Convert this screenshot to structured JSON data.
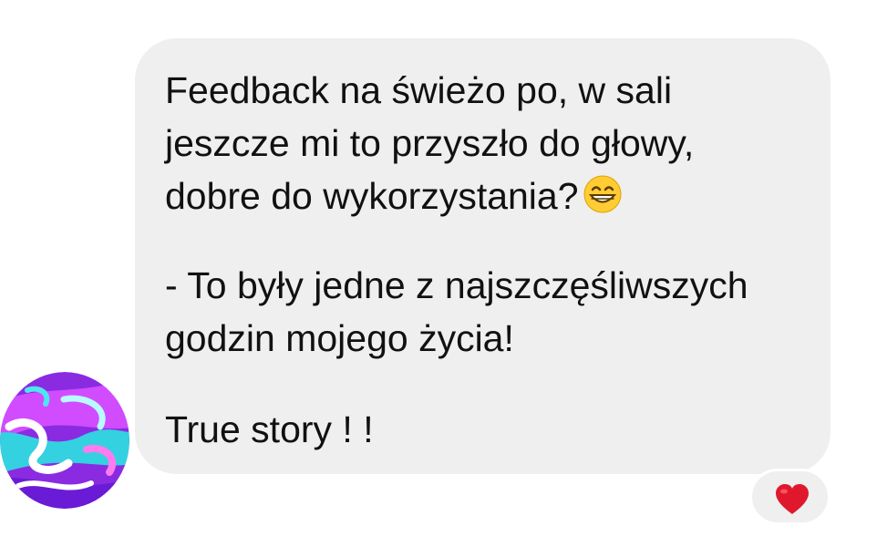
{
  "message": {
    "lines": [
      "Feedback na świeżo po, w sali",
      "jeszcze mi to przyszło do głowy,",
      "dobre do wykorzystania?",
      "- To były jedne z najszczęśliwszych",
      "godzin mojego życia!",
      "True story ! !"
    ],
    "emoji": "grinning-face-icon"
  },
  "reaction": {
    "emoji": "red-heart-icon",
    "color": "#e0182d"
  },
  "colors": {
    "bubble": "#efefef",
    "text": "#111111"
  }
}
